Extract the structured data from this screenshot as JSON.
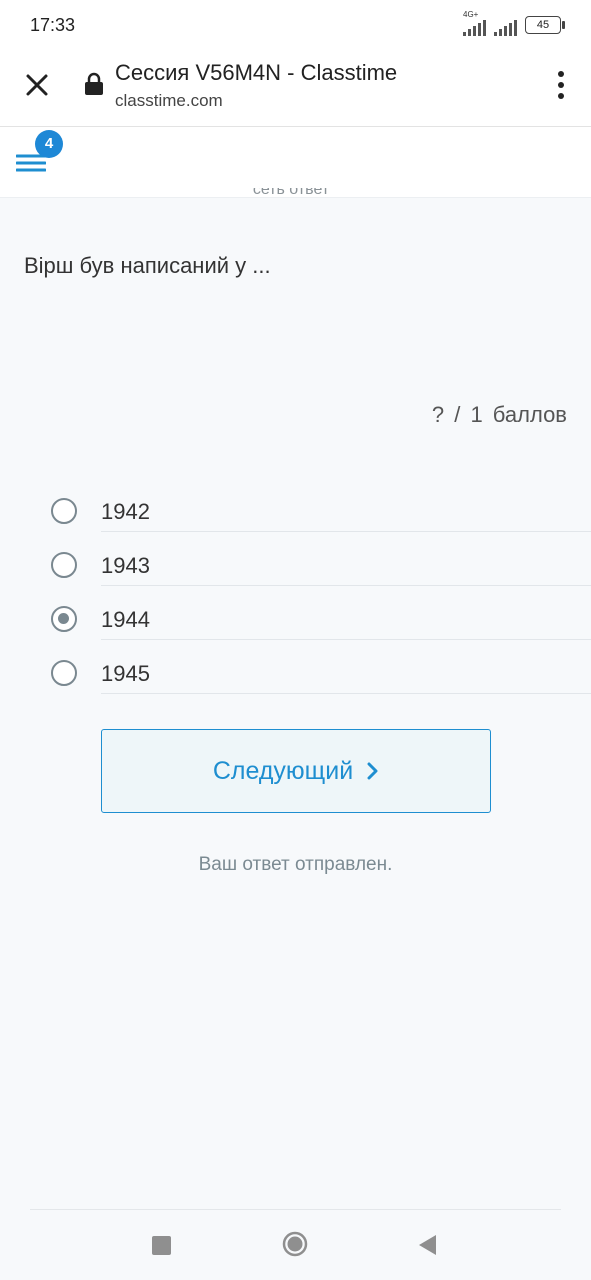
{
  "status": {
    "time": "17:33",
    "network_label": "4G+",
    "battery": "45"
  },
  "browser": {
    "title": "Сессия V56M4N - Classtime",
    "url": "classtime.com"
  },
  "app": {
    "notification_count": "4",
    "cut_text": "сеть ответ"
  },
  "question": {
    "text": "Вірш був написаний у ...",
    "points": "? / 1 баллов",
    "options": [
      {
        "label": "1942",
        "selected": false
      },
      {
        "label": "1943",
        "selected": false
      },
      {
        "label": "1944",
        "selected": true
      },
      {
        "label": "1945",
        "selected": false
      }
    ]
  },
  "next_button_label": "Следующий",
  "submitted_message": "Ваш ответ отправлен.",
  "colors": {
    "accent": "#1e8ed0",
    "badge": "#1e88d6",
    "radio": "#7a8890",
    "background": "#f7f9fb"
  }
}
